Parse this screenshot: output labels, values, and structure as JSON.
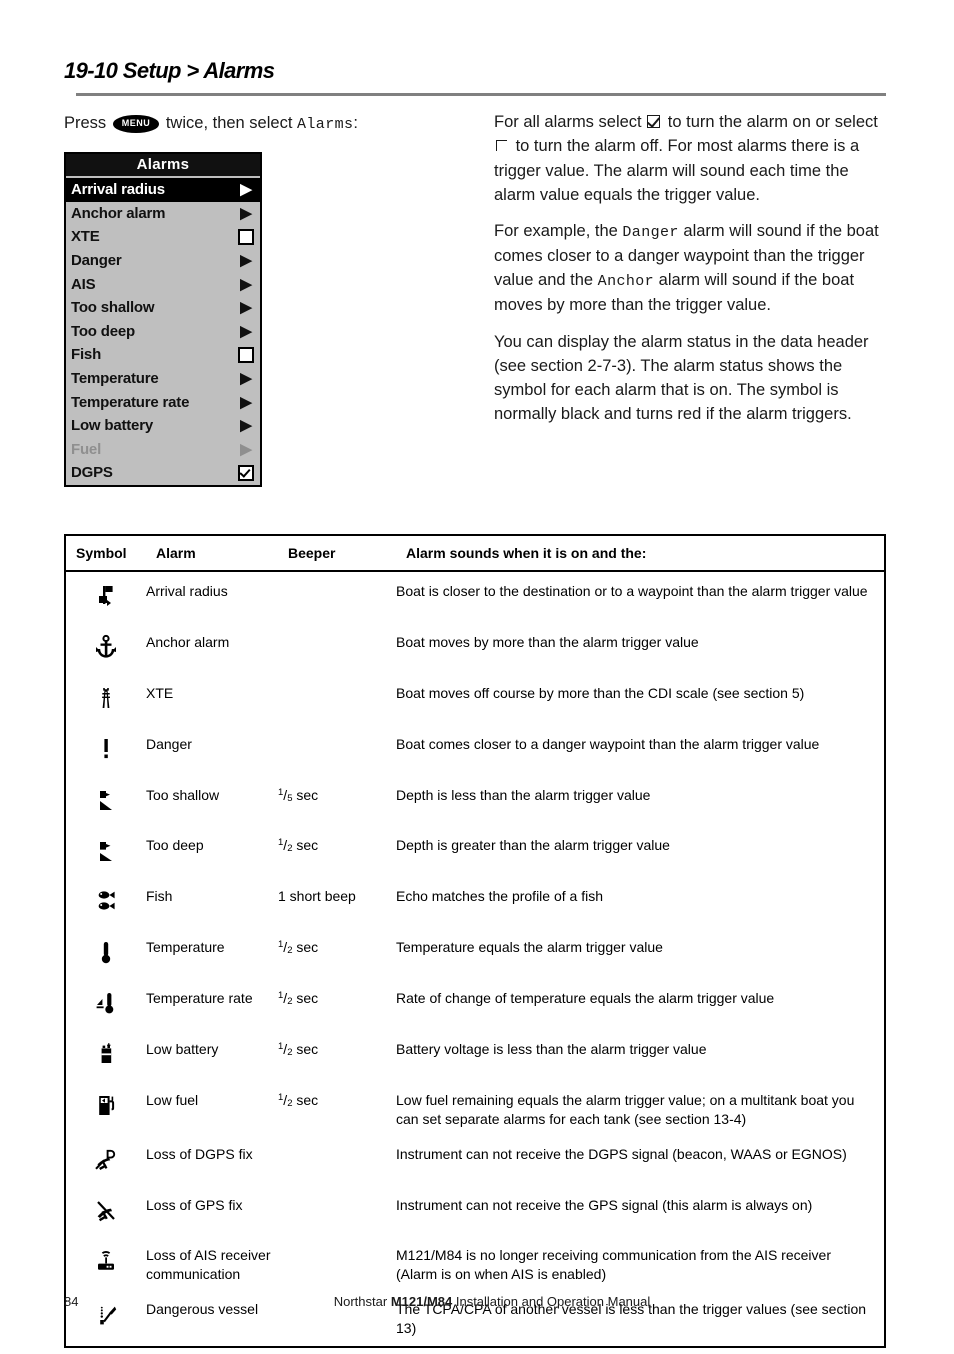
{
  "page": {
    "title": "19-10 Setup > Alarms",
    "number": "84",
    "footer_pre": "Northstar ",
    "footer_model": "M121/M84",
    "footer_post": " Installation and Operation Manual"
  },
  "intro": {
    "press_pre": "Press ",
    "menu_key": "MENU",
    "press_mid": " twice, then select ",
    "menu_word": "Alarms",
    "press_post": ":"
  },
  "device_menu": {
    "title": "Alarms",
    "items": [
      {
        "label": "Arrival radius",
        "control": "arrow",
        "selected": true,
        "disabled": false
      },
      {
        "label": "Anchor alarm",
        "control": "arrow",
        "selected": false,
        "disabled": false
      },
      {
        "label": "XTE",
        "control": "checkbox",
        "checked": false,
        "selected": false,
        "disabled": false
      },
      {
        "label": "Danger",
        "control": "arrow",
        "selected": false,
        "disabled": false
      },
      {
        "label": "AIS",
        "control": "arrow",
        "selected": false,
        "disabled": false
      },
      {
        "label": "Too shallow",
        "control": "arrow",
        "selected": false,
        "disabled": false
      },
      {
        "label": "Too deep",
        "control": "arrow",
        "selected": false,
        "disabled": false
      },
      {
        "label": "Fish",
        "control": "checkbox",
        "checked": false,
        "selected": false,
        "disabled": false
      },
      {
        "label": "Temperature",
        "control": "arrow",
        "selected": false,
        "disabled": false
      },
      {
        "label": "Temperature rate",
        "control": "arrow",
        "selected": false,
        "disabled": false
      },
      {
        "label": "Low battery",
        "control": "arrow",
        "selected": false,
        "disabled": false
      },
      {
        "label": "Fuel",
        "control": "arrow",
        "selected": false,
        "disabled": true
      },
      {
        "label": "DGPS",
        "control": "checkbox",
        "checked": true,
        "selected": false,
        "disabled": false
      }
    ]
  },
  "body": {
    "p1_a": "For all alarms select ",
    "p1_b": " to turn the alarm on or select ",
    "p1_c": " to turn the alarm off. For most alarms there is a trigger value. The alarm will sound each time the alarm value equals the trigger value.",
    "p2_a": "For example, the ",
    "p2_mono1": "Danger",
    "p2_b": " alarm will sound if the boat comes closer to a danger waypoint than the trigger value and the ",
    "p2_mono2": "Anchor",
    "p2_c": " alarm will sound if the boat moves by more than the trigger value.",
    "p3": "You can display the alarm status in the data header (see section 2-7-3). The alarm status shows the symbol for each alarm that is on. The symbol is normally black and turns red if the alarm triggers."
  },
  "table": {
    "headers": {
      "symbol": "Symbol",
      "alarm": "Alarm",
      "beeper": "Beeper",
      "desc": "Alarm sounds when it is on and the:"
    },
    "rows": [
      {
        "icon": "arrival-radius-flag-icon",
        "alarm": "Arrival radius",
        "beeper": "",
        "desc": "Boat is closer to the destination or to a waypoint than the alarm trigger value"
      },
      {
        "icon": "anchor-icon",
        "alarm": "Anchor alarm",
        "beeper": "",
        "desc": "Boat moves by more than the alarm trigger value"
      },
      {
        "icon": "xte-track-icon",
        "alarm": "XTE",
        "beeper": "",
        "desc": "Boat moves off course by more than the CDI scale (see section 5)"
      },
      {
        "icon": "danger-exclamation-icon",
        "alarm": "Danger",
        "beeper": "",
        "desc": "Boat comes closer to a danger waypoint than the alarm trigger value"
      },
      {
        "icon": "too-shallow-icon",
        "alarm": "Too shallow",
        "beeper_num": "1",
        "beeper_den": "5",
        "beeper_unit": "sec",
        "desc": "Depth is less than the alarm trigger value"
      },
      {
        "icon": "too-deep-icon",
        "alarm": "Too deep",
        "beeper_num": "1",
        "beeper_den": "2",
        "beeper_unit": "sec",
        "desc": "Depth is greater than the alarm trigger value"
      },
      {
        "icon": "fish-icon",
        "alarm": "Fish",
        "beeper": "1 short beep",
        "desc": "Echo matches the profile of a fish"
      },
      {
        "icon": "thermometer-icon",
        "alarm": "Temperature",
        "beeper_num": "1",
        "beeper_den": "2",
        "beeper_unit": "sec",
        "desc": "Temperature equals the alarm trigger value"
      },
      {
        "icon": "temperature-rate-icon",
        "alarm": "Temperature rate",
        "beeper_num": "1",
        "beeper_den": "2",
        "beeper_unit": "sec",
        "desc": "Rate of change of temperature equals the alarm trigger value"
      },
      {
        "icon": "battery-icon",
        "alarm": "Low battery",
        "beeper_num": "1",
        "beeper_den": "2",
        "beeper_unit": "sec",
        "desc": "Battery voltage is less than the alarm trigger value"
      },
      {
        "icon": "fuel-pump-icon",
        "alarm": "Low fuel",
        "beeper_num": "1",
        "beeper_den": "2",
        "beeper_unit": "sec",
        "desc": "Low fuel remaining equals the alarm trigger value; on a multitank boat you can set separate alarms for each tank (see section 13-4)"
      },
      {
        "icon": "loss-of-dgps-fix-icon",
        "alarm": "Loss of DGPS fix",
        "beeper": "",
        "desc": "Instrument can not receive the DGPS signal (beacon, WAAS or EGNOS)"
      },
      {
        "icon": "loss-of-gps-fix-icon",
        "alarm": "Loss of GPS fix",
        "beeper": "",
        "desc": "Instrument can not receive the GPS signal  (this alarm is always on)"
      },
      {
        "icon": "loss-of-ais-icon",
        "alarm": "Loss of AIS receiver communication",
        "beeper": "",
        "desc": "M121/M84 is no longer receiving communication from the AIS receiver (Alarm is on when AIS is enabled)"
      },
      {
        "icon": "dangerous-vessel-icon",
        "alarm": "Dangerous vessel",
        "beeper": "",
        "desc": "The TCPA/CPA of another vessel is less than the trigger values (see section 13)"
      }
    ]
  },
  "colors": {
    "menu_bg": "#bfbfbf",
    "menu_header_bg": "#111111",
    "rule": "#808080",
    "text": "#1a1a1a"
  }
}
